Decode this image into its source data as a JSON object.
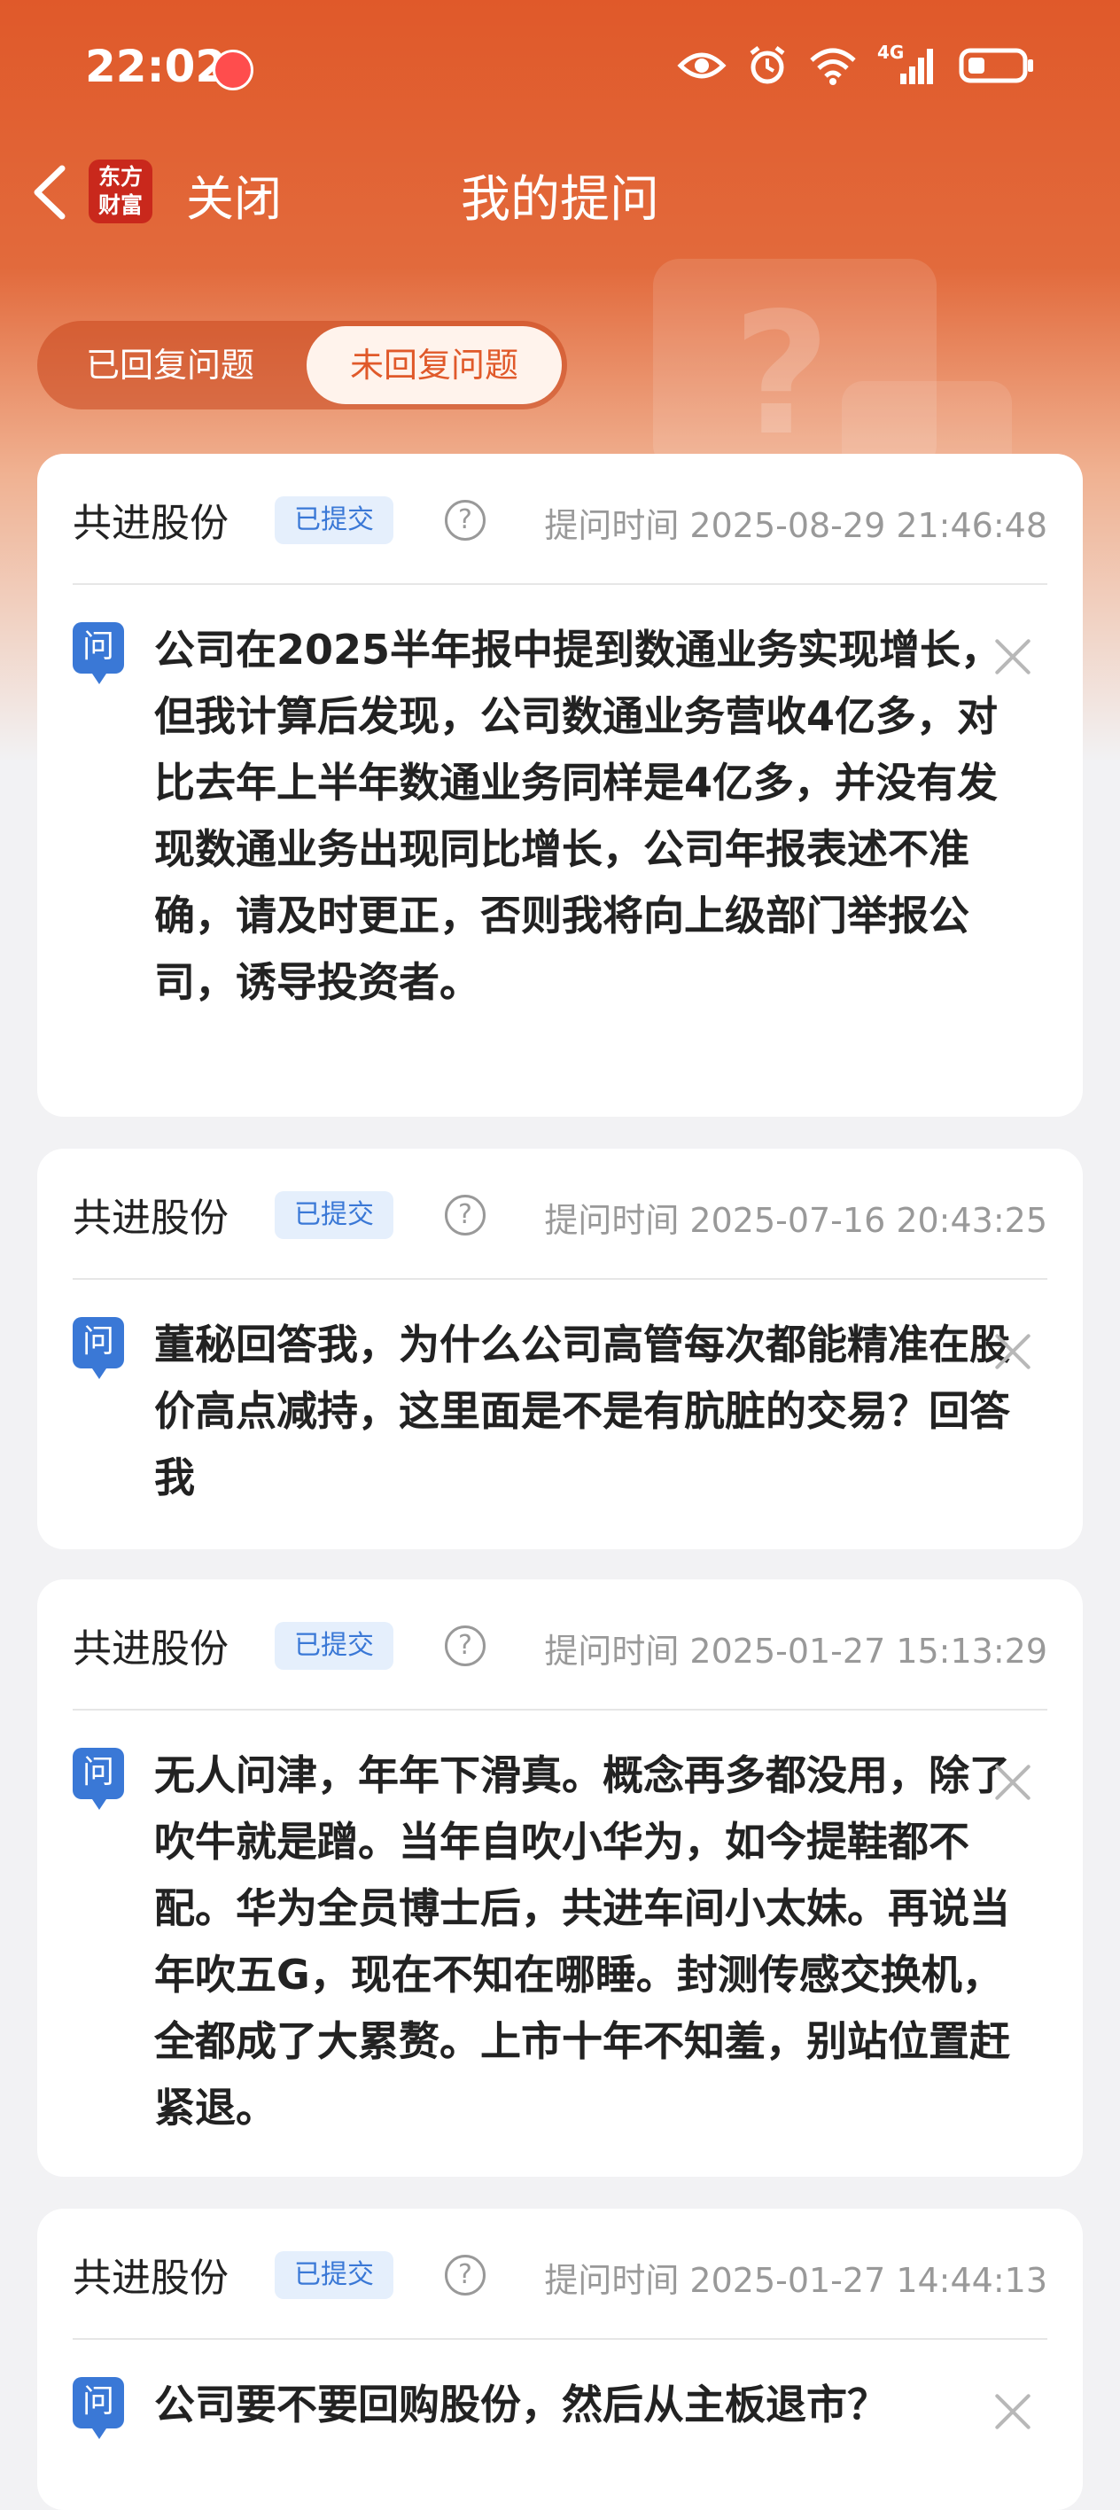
{
  "status_bar": {
    "time": "22:02",
    "network": "4G"
  },
  "nav": {
    "brand": "东方财富",
    "close_label": "关闭",
    "title": "我的提问"
  },
  "tabs": [
    {
      "label": "已回复问题",
      "active": false
    },
    {
      "label": "未回复问题",
      "active": true
    }
  ],
  "questions": [
    {
      "company": "共进股份",
      "status": "已提交",
      "time_label": "提问时间 2025-08-29 21:46:48",
      "text": "公司在2025半年报中提到数通业务实现增长，但我计算后发现，公司数通业务营收4亿多，对比去年上半年数通业务同样是4亿多，并没有发现数通业务出现同比增长，公司年报表述不准确，请及时更正，否则我将向上级部门举报公司，诱导投资者。"
    },
    {
      "company": "共进股份",
      "status": "已提交",
      "time_label": "提问时间 2025-07-16 20:43:25",
      "text": "董秘回答我，为什么公司高管每次都能精准在股价高点减持，这里面是不是有肮脏的交易？回答我"
    },
    {
      "company": "共进股份",
      "status": "已提交",
      "time_label": "提问时间 2025-01-27 15:13:29",
      "text": "无人问津，年年下滑真。概念再多都没用，除了吹牛就是蹭。当年自吹小华为，如今提鞋都不配。华为全员博士后，共进车间小太妹。再说当年吹五G，现在不知在哪睡。封测传感交换机，全都成了大累赘。上市十年不知羞，别站位置赶紧退。"
    },
    {
      "company": "共进股份",
      "status": "已提交",
      "time_label": "提问时间 2025-01-27 14:44:13",
      "text": "公司要不要回购股份，然后从主板退市？"
    }
  ],
  "icons": {
    "question_badge": "问",
    "help": "?"
  },
  "colors": {
    "brand_orange": "#e0592a",
    "badge_blue": "#3a78d6",
    "background": "#f2f2f4"
  }
}
